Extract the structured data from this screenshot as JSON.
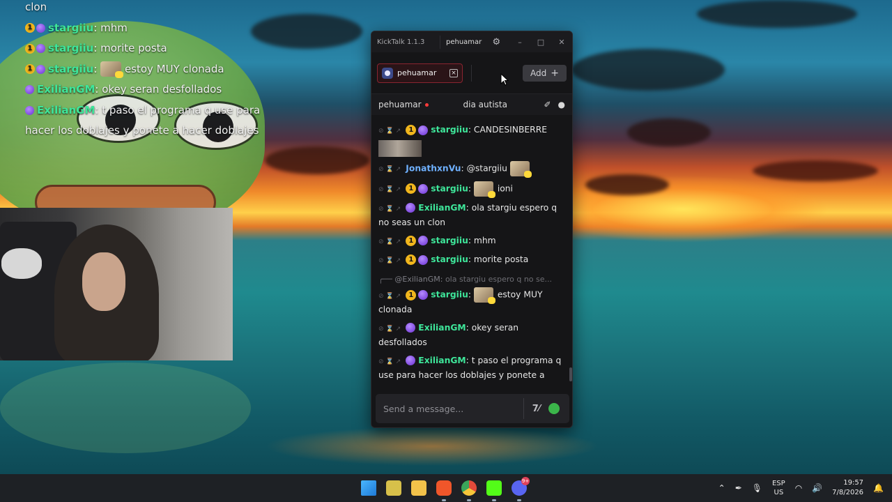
{
  "overlay_chat": [
    {
      "badges": [],
      "user": "",
      "text": "clon"
    },
    {
      "badges": [
        "gold",
        "purple"
      ],
      "user": "stargiiu",
      "text": "mhm"
    },
    {
      "badges": [
        "gold",
        "purple"
      ],
      "user": "stargiiu",
      "text": "morite posta"
    },
    {
      "badges": [
        "gold",
        "purple"
      ],
      "user": "stargiiu",
      "emote": true,
      "text": "estoy MUY clonada"
    },
    {
      "badges": [
        "purple"
      ],
      "user": "ExilianGM",
      "text": "okey seran desfollados"
    },
    {
      "badges": [
        "purple"
      ],
      "user": "ExilianGM",
      "text": "t paso el programa q use para hacer los doblajes y ponete a hacer doblajes"
    }
  ],
  "kicktalk": {
    "app_title": "KickTalk 1.1.3",
    "current_user": "pehuamar",
    "settings_icon": "gear-icon",
    "window_buttons": {
      "minimize": "–",
      "maximize": "□",
      "close": "✕"
    },
    "tab": {
      "label": "pehuamar",
      "close": "×"
    },
    "add_button": {
      "label": "Add",
      "icon": "+"
    },
    "chat_header": {
      "channel": "pehuamar",
      "stream_title": "dia autista",
      "icons": [
        "pin-icon",
        "user-icon"
      ]
    },
    "messages": [
      {
        "badges": [
          "gold",
          "purple"
        ],
        "user": "stargiiu",
        "color": "green",
        "text": "CANDESINBERRE",
        "thumbnail": true
      },
      {
        "badges": [],
        "user": "JonathxnVu",
        "color": "blue",
        "text": "@stargiiu",
        "emote_after": true
      },
      {
        "badges": [
          "gold",
          "purple"
        ],
        "user": "stargiiu",
        "color": "green",
        "emote": true,
        "text": "ioni"
      },
      {
        "badges": [
          "purple"
        ],
        "user": "ExilianGM",
        "color": "green",
        "text": "ola stargiu espero q no seas un clon"
      },
      {
        "badges": [
          "gold",
          "purple"
        ],
        "user": "stargiiu",
        "color": "green",
        "text": "mhm"
      },
      {
        "badges": [
          "gold",
          "purple"
        ],
        "user": "stargiiu",
        "color": "green",
        "text": "morite posta",
        "reply_to": {
          "user": "@ExilianGM:",
          "text": "ola stargiu espero q no se..."
        }
      },
      {
        "badges": [
          "gold",
          "purple"
        ],
        "user": "stargiiu",
        "color": "green",
        "emote": true,
        "text": "estoy MUY clonada"
      },
      {
        "badges": [
          "purple"
        ],
        "user": "ExilianGM",
        "color": "green",
        "text": "okey seran desfollados"
      },
      {
        "badges": [
          "purple"
        ],
        "user": "ExilianGM",
        "color": "green",
        "text": "t paso el programa q use para hacer los doblajes y ponete a hacer doblajes"
      }
    ],
    "input": {
      "placeholder": "Send a message...",
      "icons": [
        "translate-icon",
        "emoji-icon"
      ]
    }
  },
  "taskbar": {
    "apps": [
      "windows-start-icon",
      "widgets-icon",
      "file-explorer-icon",
      "brave-browser-icon",
      "chrome-icon",
      "kick-icon",
      "discord-icon"
    ],
    "discord_badge": "9+",
    "language": {
      "line1": "ESP",
      "line2": "US"
    },
    "time": "19:57",
    "date": "7/8/2026"
  }
}
